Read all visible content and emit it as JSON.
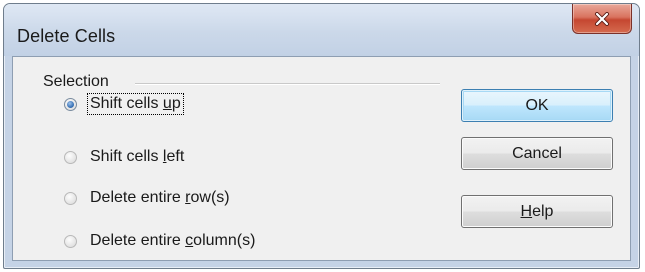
{
  "window": {
    "title": "Delete Cells"
  },
  "close_button": {
    "icon": "close-x-icon"
  },
  "selection_group": {
    "label": "Selection",
    "options": [
      {
        "pre": "Shift cells ",
        "accel": "u",
        "post": "p",
        "checked": true,
        "focused": true
      },
      {
        "pre": "Shift cells ",
        "accel": "l",
        "post": "eft",
        "checked": false,
        "focused": false
      },
      {
        "pre": "Delete entire ",
        "accel": "r",
        "post": "ow(s)",
        "checked": false,
        "focused": false
      },
      {
        "pre": "Delete entire ",
        "accel": "c",
        "post": "olumn(s)",
        "checked": false,
        "focused": false
      }
    ]
  },
  "buttons": {
    "ok": "OK",
    "cancel": "Cancel",
    "help_accel": "H",
    "help_rest": "elp"
  },
  "colors": {
    "close_button_red": "#c54731",
    "default_button_border": "#3c7fb1",
    "radio_selected": "#3b74b8",
    "dialog_face": "#f0f0f0"
  }
}
